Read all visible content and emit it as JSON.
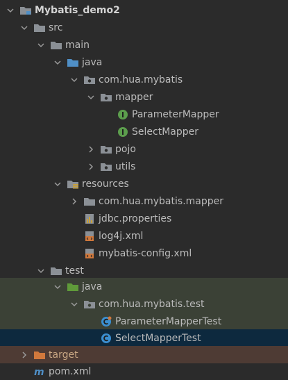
{
  "project_tree": {
    "root": "Mybatis_demo2",
    "src": "src",
    "main": "main",
    "java": "java",
    "pkg_main": "com.hua.mybatis",
    "mapper": "mapper",
    "parameter_mapper": "ParameterMapper",
    "select_mapper": "SelectMapper",
    "pojo": "pojo",
    "utils": "utils",
    "resources": "resources",
    "res_pkg": "com.hua.mybatis.mapper",
    "jdbc_props": "jdbc.properties",
    "log4j_xml": "log4j.xml",
    "mybatis_config": "mybatis-config.xml",
    "test": "test",
    "test_java": "java",
    "pkg_test": "com.hua.mybatis.test",
    "parameter_mapper_test": "ParameterMapperTest",
    "select_mapper_test": "SelectMapperTest",
    "target": "target",
    "pom": "pom.xml"
  },
  "colors": {
    "background": "#2b2b2b",
    "test_bg": "#3b4136",
    "selected_bg": "#0d293e",
    "excluded_bg": "#4e3b34",
    "folder": "#8b9096",
    "source_folder": "#4f8fc6",
    "test_folder": "#5f9a3a",
    "interface_icon": "#5c9e4d",
    "class_icon": "#3b8fd1",
    "target_folder": "#d0783c"
  }
}
